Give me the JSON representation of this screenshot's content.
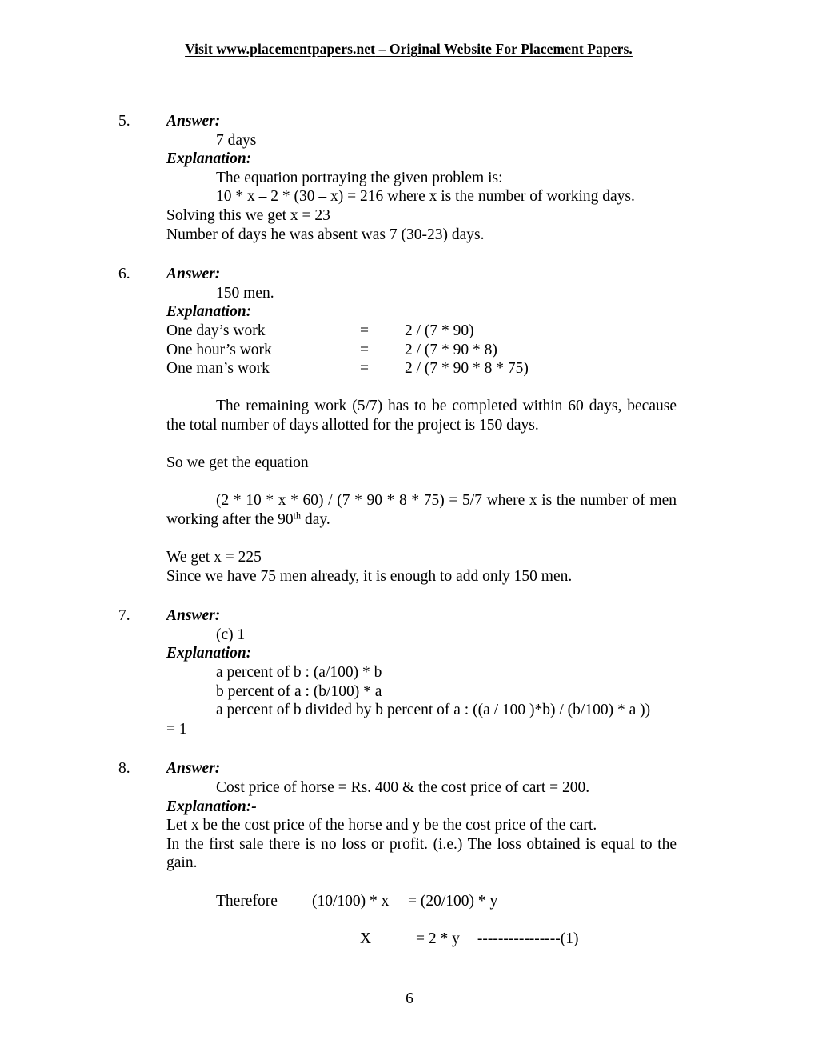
{
  "header": {
    "prefix": "Visit ",
    "site": "www.placementpapers.net",
    "suffix": " – Original Website For Placement Papers."
  },
  "labels": {
    "answer": "Answer:",
    "explanation": "Explanation:",
    "explanation_dash": "Explanation:-"
  },
  "questions": [
    {
      "number": "5.",
      "answer_text": "7 days",
      "lines": [
        "The equation portraying the given problem is:",
        " 10 *  x – 2 * (30 – x) =  216  where x is the number of working days.",
        "Solving this we get x = 23",
        "Number of days he was absent was 7 (30-23) days."
      ]
    },
    {
      "number": "6.",
      "answer_text": "150 men.",
      "work_table": {
        "rows": [
          {
            "label": "One day’s work",
            "eq": "=",
            "value": "2 / (7 * 90)"
          },
          {
            "label": "One hour’s work",
            "eq": "=",
            "value": "2 / (7 * 90 * 8)"
          },
          {
            "label": "One man’s work",
            "eq": "=",
            "value": "2 / (7 * 90 * 8 * 75)"
          }
        ]
      },
      "paragraph1": "The remaining work (5/7) has to be completed within 60 days, because the total number of days allotted for the project is 150 days.",
      "paragraph2": "So we get the equation",
      "equation_part1": "(2 * 10 * x * 60) / (7 * 90 *  8 * 75)  =  5/7  where x is the number of men working after the 90",
      "equation_superscript": "th",
      "equation_part2": " day.",
      "closing": [
        "We get x = 225",
        "Since we have 75 men already, it is enough to add only 150 men."
      ]
    },
    {
      "number": "7.",
      "answer_text": "(c) 1",
      "lines": [
        "a percent of b : (a/100) * b",
        "b percent of a : (b/100) * a",
        "a percent of b divided by b percent of a : ((a / 100 )*b) /  (b/100) * a ))"
      ],
      "result": "= 1"
    },
    {
      "number": "8.",
      "answer_text": "Cost price of horse =  Rs. 400 & the cost price of cart = 200.",
      "lines": [
        "Let x be the cost price of the horse and y be the cost price of the cart.",
        "In the first sale there is no loss or profit. (i.e.) The loss obtained is equal to the gain."
      ],
      "equations": {
        "therefore_label": "Therefore",
        "lhs1": "(10/100) * x",
        "eq1": "=",
        "rhs1": "(20/100) * y",
        "lhs2": "X",
        "eq2": "=",
        "rhs2": "2 * y",
        "ref_dashes": "----------------",
        "ref_number": "(1)"
      }
    }
  ],
  "footer": {
    "page_number": "6"
  }
}
